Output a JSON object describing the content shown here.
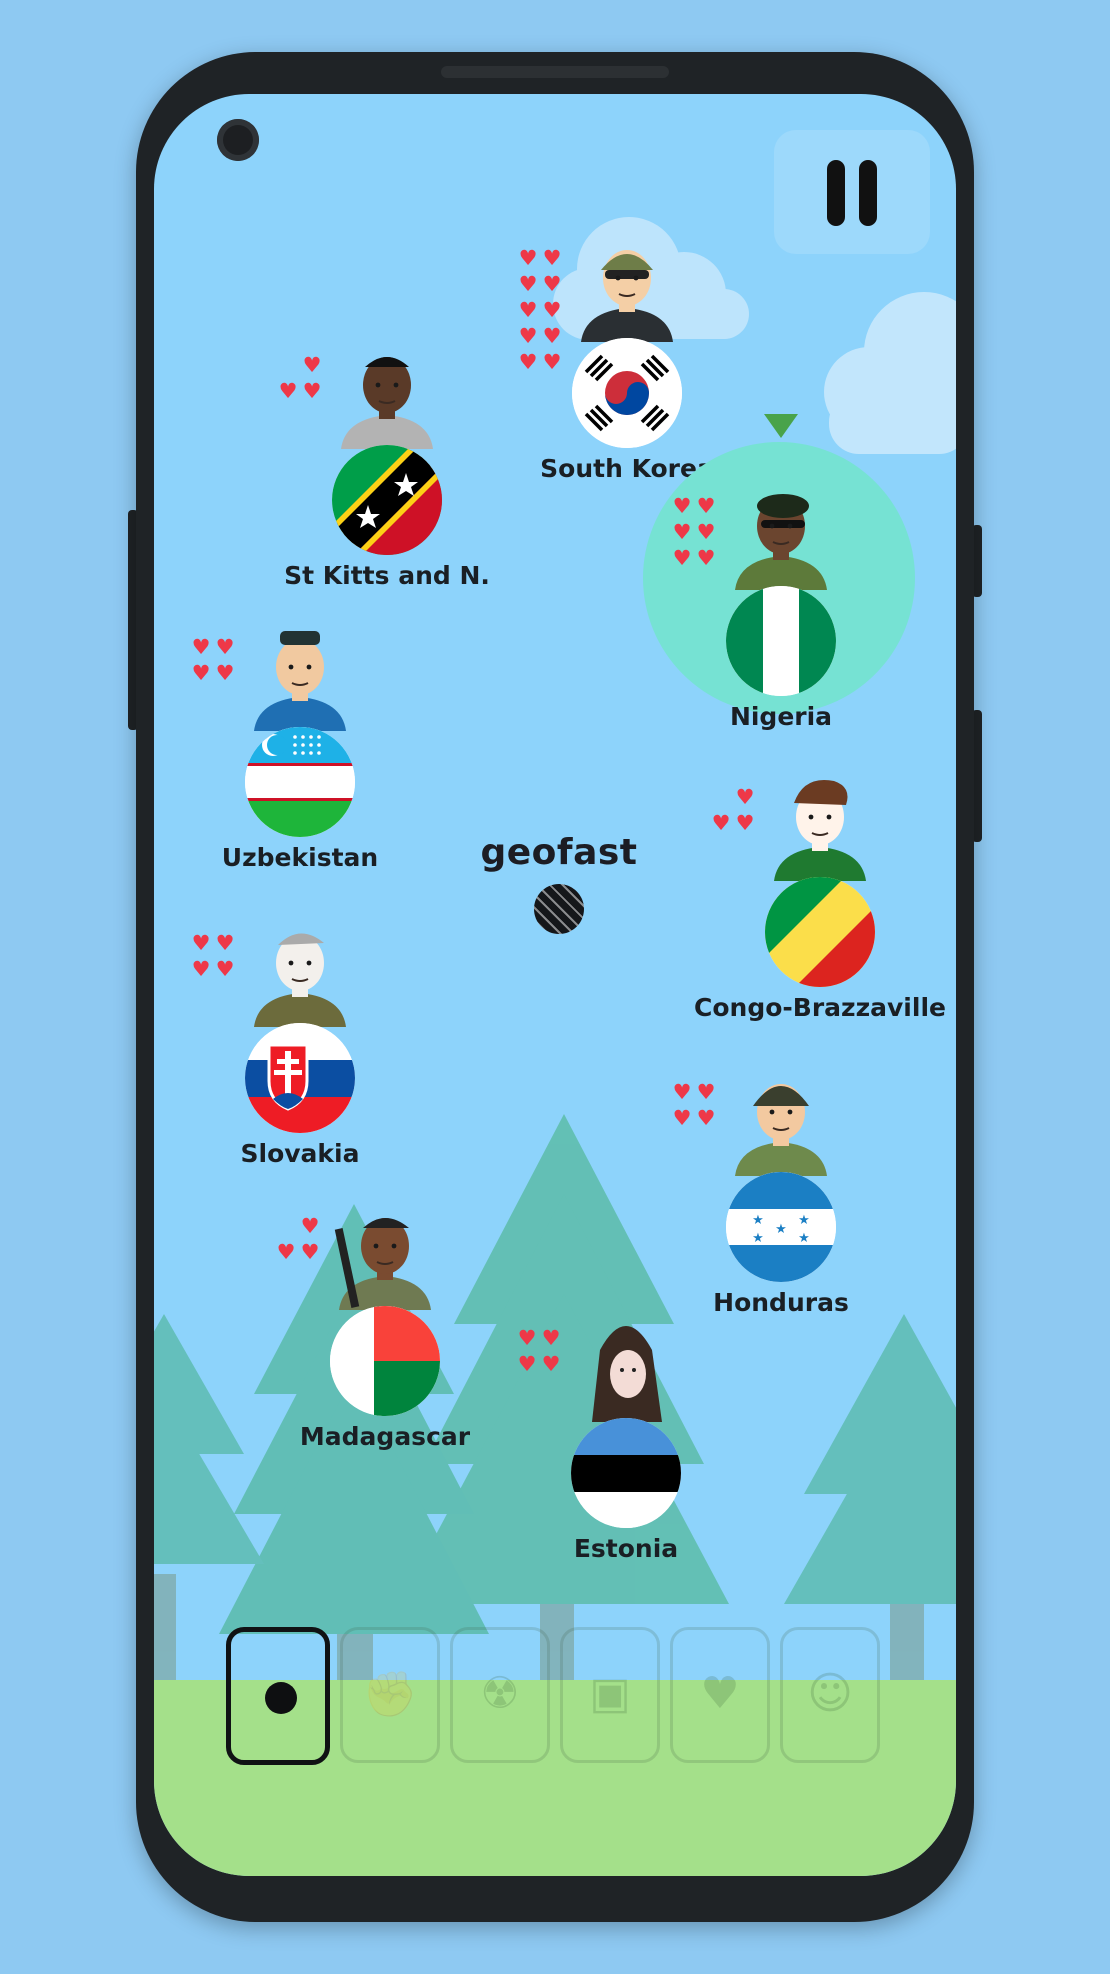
{
  "app": {
    "logo": "geofast",
    "pause_label": "Pause",
    "accent_green": "#49a34a",
    "highlight_color": "#76e2d3",
    "sky_color": "#8dd3fb"
  },
  "players": [
    {
      "name": "South Korea",
      "hearts": 10,
      "flag": "south-korea",
      "avatar": "soldier-helmet-goggles"
    },
    {
      "name": "St Kitts and N.",
      "hearts": 3,
      "flag": "st-kitts",
      "avatar": "man-in-suit"
    },
    {
      "name": "Nigeria",
      "hearts": 6,
      "flag": "nigeria",
      "avatar": "soldier-beret",
      "current_turn": true
    },
    {
      "name": "Uzbekistan",
      "hearts": 4,
      "flag": "uzbekistan",
      "avatar": "old-man-cap"
    },
    {
      "name": "Congo-Brazzaville",
      "hearts": 3,
      "flag": "congo",
      "avatar": "wojak-tshirt"
    },
    {
      "name": "Slovakia",
      "hearts": 4,
      "flag": "slovakia",
      "avatar": "old-officer"
    },
    {
      "name": "Honduras",
      "hearts": 4,
      "flag": "honduras",
      "avatar": "tank-helmet-soldier"
    },
    {
      "name": "Madagascar",
      "hearts": 3,
      "flag": "madagascar",
      "avatar": "rifle-soldier"
    },
    {
      "name": "Estonia",
      "hearts": 4,
      "flag": "estonia",
      "avatar": "hooded-figure"
    }
  ],
  "toolbar": {
    "items": [
      {
        "icon": "dot-icon",
        "active": true
      },
      {
        "icon": "fist-icon",
        "active": false
      },
      {
        "icon": "radioactive-icon",
        "active": false
      },
      {
        "icon": "lock-icon",
        "active": false
      },
      {
        "icon": "heart-icon",
        "active": false
      },
      {
        "icon": "face-icon",
        "active": false
      }
    ]
  }
}
